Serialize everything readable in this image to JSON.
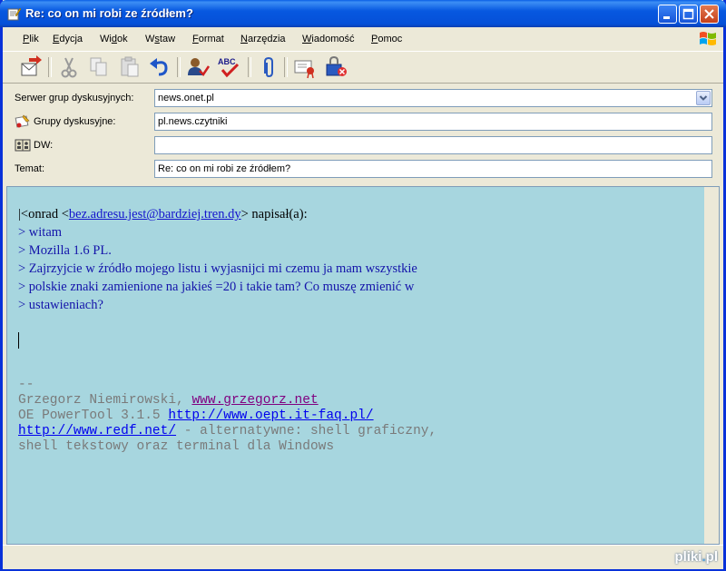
{
  "window": {
    "title": "Re: co on mi robi ze źródłem?",
    "controls": [
      "minimize",
      "maximize",
      "close"
    ]
  },
  "menu": [
    {
      "label": "Plik",
      "ul": "P"
    },
    {
      "label": "Edycja",
      "ul": "E"
    },
    {
      "label": "Widok",
      "ul": "W"
    },
    {
      "label": "Wstaw",
      "ul": "s"
    },
    {
      "label": "Format",
      "ul": "F"
    },
    {
      "label": "Narzędzia",
      "ul": "N"
    },
    {
      "label": "Wiadomość",
      "ul": "W"
    },
    {
      "label": "Pomoc",
      "ul": "P"
    }
  ],
  "toolbar": {
    "items": [
      "send-icon",
      "cut-icon",
      "copy-icon",
      "paste-icon",
      "undo-icon",
      "check-names-icon",
      "spelling-icon",
      "attach-icon",
      "sign-icon",
      "encrypt-icon"
    ]
  },
  "form": {
    "server_label": "Serwer grup dyskusyjnych:",
    "server_value": "news.onet.pl",
    "groups_label": "Grupy dyskusyjne:",
    "groups_value": "pl.news.czytniki",
    "cc_label": "DW:",
    "cc_value": "",
    "subject_label": "Temat:",
    "subject_value": "Re: co on mi robi ze źródłem?"
  },
  "message": {
    "intro_prefix": "|<onrad <",
    "intro_email": "bez.adresu.jest@bardziej.tren.dy",
    "intro_suffix": "> napisał(a):",
    "quote_lines": [
      "> witam",
      "> Mozilla 1.6 PL.",
      "> Zajrzyjcie w źródło mojego listu i wyjasnijci mi czemu ja mam wszystkie",
      "> polskie znaki zamienione na jakieś =20 i takie tam? Co muszę zmienić w",
      "> ustawieniach?"
    ],
    "sig_sep": "--",
    "sig_name": "Grzegorz Niemirowski, ",
    "sig_name_link": "www.grzegorz.net",
    "sig_tool": "OE PowerTool 3.1.5 ",
    "sig_tool_link": "http://www.oept.it-faq.pl/",
    "sig_redf_link": "http://www.redf.net/",
    "sig_redf_text": " - alternatywne: shell graficzny,",
    "sig_last": "shell tekstowy oraz terminal dla Windows"
  },
  "watermark": {
    "prefix": "pliki",
    "dot": ".",
    "suffix": "pl"
  }
}
